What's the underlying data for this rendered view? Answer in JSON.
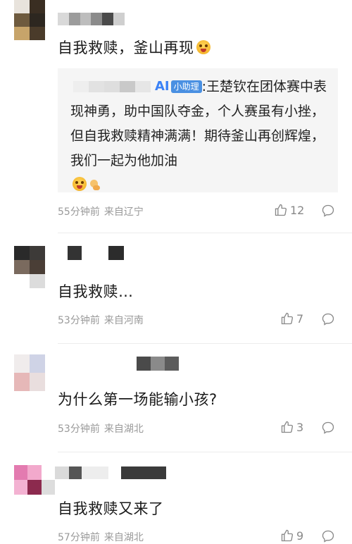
{
  "comments": [
    {
      "text": "自我救赎，釜山再现",
      "has_emoji": true,
      "reply": {
        "prefix": ":王楚钦在团体赛中表现神勇，助中国队夺金，个人赛虽有小挫，但自我救赎精神满满！期待釜山再创辉煌，我们一起为他加油",
        "badge_logo": "AI",
        "badge_label": "小助理"
      },
      "time": "55分钟前",
      "location": "来自辽宁",
      "likes": "12"
    },
    {
      "text": "自我救赎…",
      "time": "53分钟前",
      "location": "来自河南",
      "likes": "7"
    },
    {
      "text": "为什么第一场能输小孩?",
      "time": "53分钟前",
      "location": "来自湖北",
      "likes": "3"
    },
    {
      "text": "自我救赎又来了",
      "time": "57分钟前",
      "location": "来自湖北",
      "likes": "9"
    }
  ],
  "icons": {
    "like": "thumbs-up-icon",
    "reply": "comment-bubble-icon"
  },
  "colors": {
    "meta_text": "#999999",
    "ai_blue": "#4a90e2",
    "reply_bg": "#f5f5f5"
  }
}
